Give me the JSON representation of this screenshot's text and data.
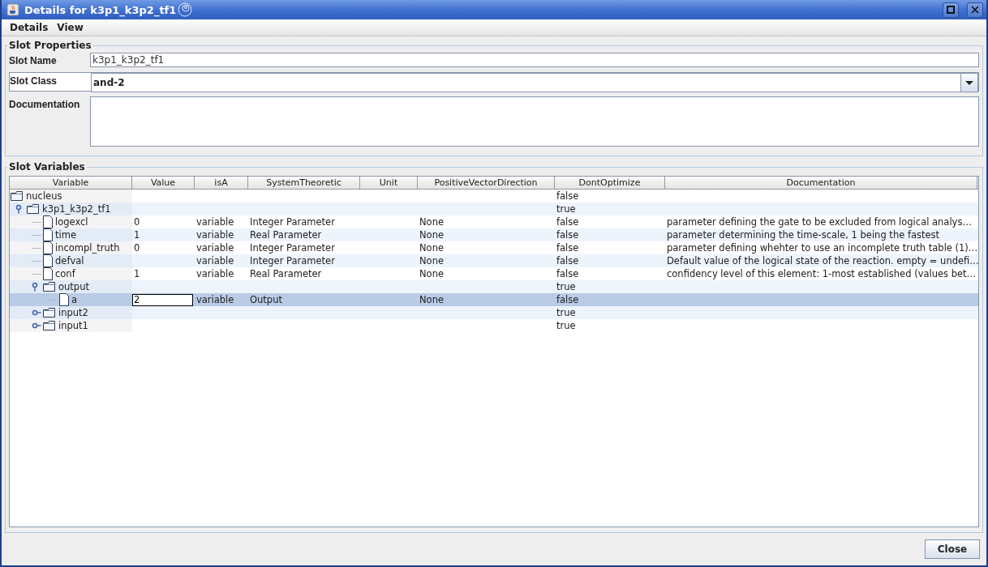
{
  "window": {
    "title": "Details for k3p1_k3p2_tf1"
  },
  "menu": [
    {
      "label": "Details"
    },
    {
      "label": "View"
    }
  ],
  "slot_properties": {
    "legend": "Slot Properties",
    "fields": [
      {
        "label": "Slot Name",
        "kind": "text",
        "value": "k3p1_k3p2_tf1"
      },
      {
        "label": "Slot Class",
        "kind": "combo",
        "value": "and-2"
      },
      {
        "label": "Documentation",
        "kind": "textarea"
      }
    ]
  },
  "slot_variables": {
    "legend": "Slot Variables",
    "table": {
      "columns": [
        "Variable",
        "Value",
        "isA",
        "SystemTheoretic",
        "Unit",
        "PositiveVectorDirection",
        "DontOptimize",
        "Documentation"
      ],
      "rows": [
        {
          "kind": "folder",
          "name": "nucleus",
          "selected": false,
          "dont_optimize": "false",
          "children": [
            {
              "kind": "folder",
              "name": "k3p1_k3p2_tf1",
              "expanded": true,
              "selected": false,
              "dont_optimize": "true",
              "children": [
                {
                  "kind": "leaf",
                  "name": "logexcl",
                  "selected": false,
                  "editing": false,
                  "value": "0",
                  "is_a": "variable",
                  "system_theoretic": "Integer Parameter",
                  "positive_vector_direction": "None",
                  "dont_optimize": "false",
                  "documentation": "parameter defining the gate to be excluded from logical  analys…"
                },
                {
                  "kind": "leaf",
                  "name": "time",
                  "selected": false,
                  "editing": false,
                  "value": "1",
                  "is_a": "variable",
                  "system_theoretic": "Real Parameter",
                  "positive_vector_direction": "None",
                  "dont_optimize": "false",
                  "documentation": "parameter determining the time-scale, 1 being the fastest"
                },
                {
                  "kind": "leaf",
                  "name": "incompl_truth",
                  "selected": false,
                  "editing": false,
                  "value": "0",
                  "is_a": "variable",
                  "system_theoretic": "Integer Parameter",
                  "positive_vector_direction": "None",
                  "dont_optimize": "false",
                  "documentation": "parameter defining whehter to use an incomplete truth table (1)…"
                },
                {
                  "kind": "leaf",
                  "name": "defval",
                  "selected": false,
                  "editing": false,
                  "is_a": "variable",
                  "system_theoretic": "Integer Parameter",
                  "positive_vector_direction": "None",
                  "dont_optimize": "false",
                  "documentation": "Default value of the logical state of the reaction. empty = undefi…"
                },
                {
                  "kind": "leaf",
                  "name": "conf",
                  "selected": false,
                  "editing": false,
                  "value": "1",
                  "is_a": "variable",
                  "system_theoretic": "Real Parameter",
                  "positive_vector_direction": "None",
                  "dont_optimize": "false",
                  "documentation": "confidency level of this element: 1-most established (values bet…"
                },
                {
                  "kind": "folder",
                  "name": "output",
                  "expanded": true,
                  "selected": false,
                  "dont_optimize": "true",
                  "children": [
                    {
                      "kind": "leaf",
                      "name": "a",
                      "selected": true,
                      "editing": true,
                      "value": "2",
                      "is_a": "variable",
                      "system_theoretic": "Output",
                      "positive_vector_direction": "None",
                      "dont_optimize": "false"
                    }
                  ]
                },
                {
                  "kind": "folder",
                  "name": "input2",
                  "expanded": false,
                  "selected": false,
                  "dont_optimize": "true"
                },
                {
                  "kind": "folder",
                  "name": "input1",
                  "expanded": false,
                  "selected": false,
                  "dont_optimize": "true"
                }
              ]
            }
          ]
        }
      ]
    }
  },
  "buttons": [
    {
      "label": "Close"
    }
  ]
}
